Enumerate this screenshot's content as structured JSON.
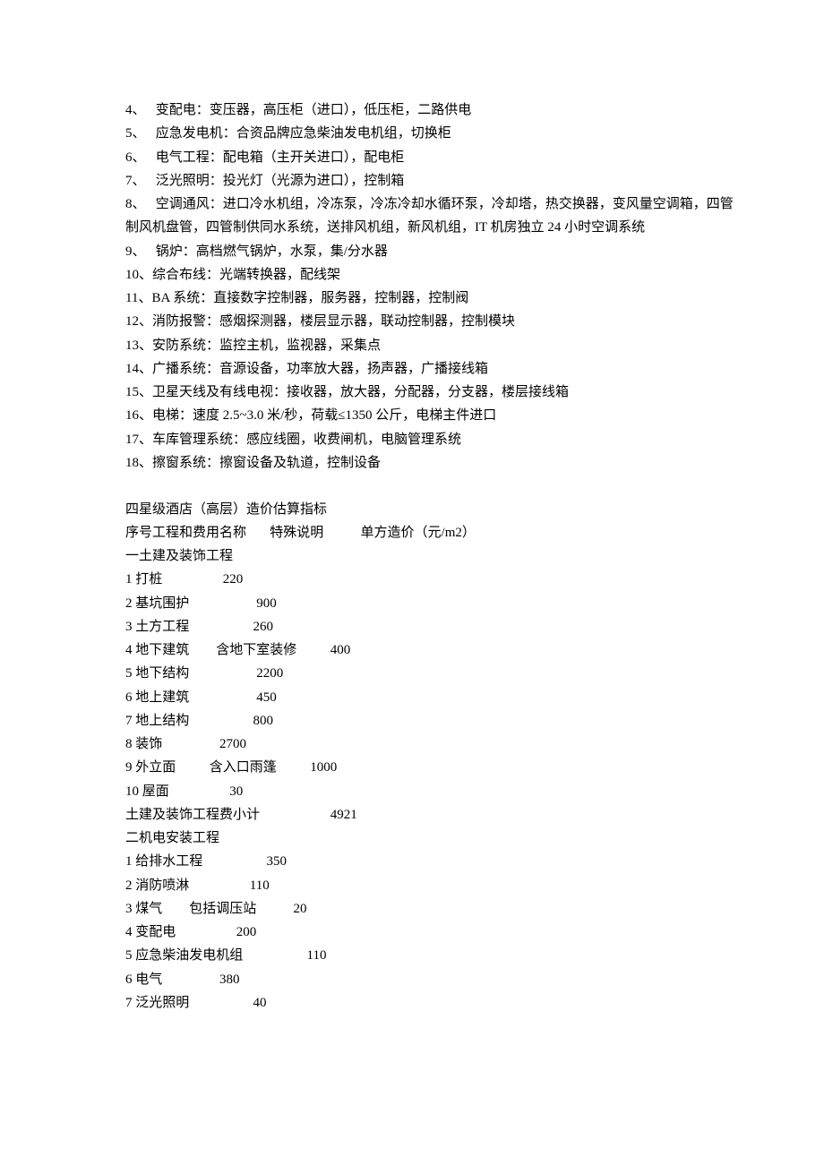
{
  "numbered_items": [
    {
      "num": "4、",
      "text": "   变配电：变压器，高压柜（进口），低压柜，二路供电"
    },
    {
      "num": "5、",
      "text": "   应急发电机：合资品牌应急柴油发电机组，切换柜"
    },
    {
      "num": "6、",
      "text": "   电气工程：配电箱（主开关进口），配电柜"
    },
    {
      "num": "7、",
      "text": "   泛光照明：投光灯（光源为进口），控制箱"
    },
    {
      "num": "8、",
      "text": "   空调通风：进口冷水机组，冷冻泵，冷冻冷却水循环泵，冷却塔，热交换器，变风量空调箱，四管"
    },
    {
      "num": "",
      "text": "制风机盘管，四管制供同水系统，送排风机组，新风机组，IT 机房独立 24 小时空调系统"
    },
    {
      "num": "9、",
      "text": "   锅炉：高档燃气锅炉，水泵，集/分水器"
    },
    {
      "num": "10、",
      "text": "综合布线：光端转换器，配线架"
    },
    {
      "num": "11、",
      "text": "BA 系统：直接数字控制器，服务器，控制器，控制阀"
    },
    {
      "num": "12、",
      "text": "消防报警：感烟探测器，楼层显示器，联动控制器，控制模块"
    },
    {
      "num": "13、",
      "text": "安防系统：监控主机，监视器，采集点"
    },
    {
      "num": "14、",
      "text": "广播系统：音源设备，功率放大器，扬声器，广播接线箱"
    },
    {
      "num": "15、",
      "text": "卫星天线及有线电视：接收器，放大器，分配器，分支器，楼层接线箱"
    },
    {
      "num": "16、",
      "text": "电梯：速度 2.5~3.0 米/秒，荷载≤1350 公斤，电梯主件进口"
    },
    {
      "num": "17、",
      "text": "车库管理系统：感应线圈，收费闸机，电脑管理系统"
    },
    {
      "num": "18、",
      "text": "擦窗系统：擦窗设备及轨道，控制设备"
    }
  ],
  "section_title": "四星级酒店（高层）造价估算指标",
  "table_header": {
    "col1": "序号工程和费用名称",
    "col2": "特殊说明",
    "col3": "单方造价（元/m2）"
  },
  "section1_title": "一土建及装饰工程",
  "section1_rows": [
    {
      "name": "1 打桩",
      "note": "",
      "price": "220"
    },
    {
      "name": "2 基坑围护",
      "note": "",
      "price": "900"
    },
    {
      "name": "3 土方工程",
      "note": "",
      "price": "260"
    },
    {
      "name": "4 地下建筑",
      "note": "含地下室装修",
      "price": "400"
    },
    {
      "name": "5 地下结构",
      "note": "",
      "price": "2200"
    },
    {
      "name": "6 地上建筑",
      "note": "",
      "price": "450"
    },
    {
      "name": "7 地上结构",
      "note": "",
      "price": "800"
    },
    {
      "name": "8 装饰",
      "note": "",
      "price": "2700"
    },
    {
      "name": "9 外立面",
      "note": "含入口雨篷",
      "price": "1000"
    },
    {
      "name": "10 屋面",
      "note": "",
      "price": "30"
    }
  ],
  "section1_subtotal": {
    "name": "土建及装饰工程费小计",
    "note": "",
    "price": "4921"
  },
  "section2_title": "二机电安装工程",
  "section2_rows": [
    {
      "name": "1 给排水工程",
      "note": "",
      "price": "350"
    },
    {
      "name": "2 消防喷淋",
      "note": "",
      "price": "110"
    },
    {
      "name": "3 煤气",
      "note": "包括调压站",
      "price": "20"
    },
    {
      "name": "4 变配电",
      "note": "",
      "price": "200"
    },
    {
      "name": "5 应急柴油发电机组",
      "note": "",
      "price": "110"
    },
    {
      "name": "6 电气",
      "note": "",
      "price": "380"
    },
    {
      "name": "7 泛光照明",
      "note": "",
      "price": "40"
    }
  ]
}
